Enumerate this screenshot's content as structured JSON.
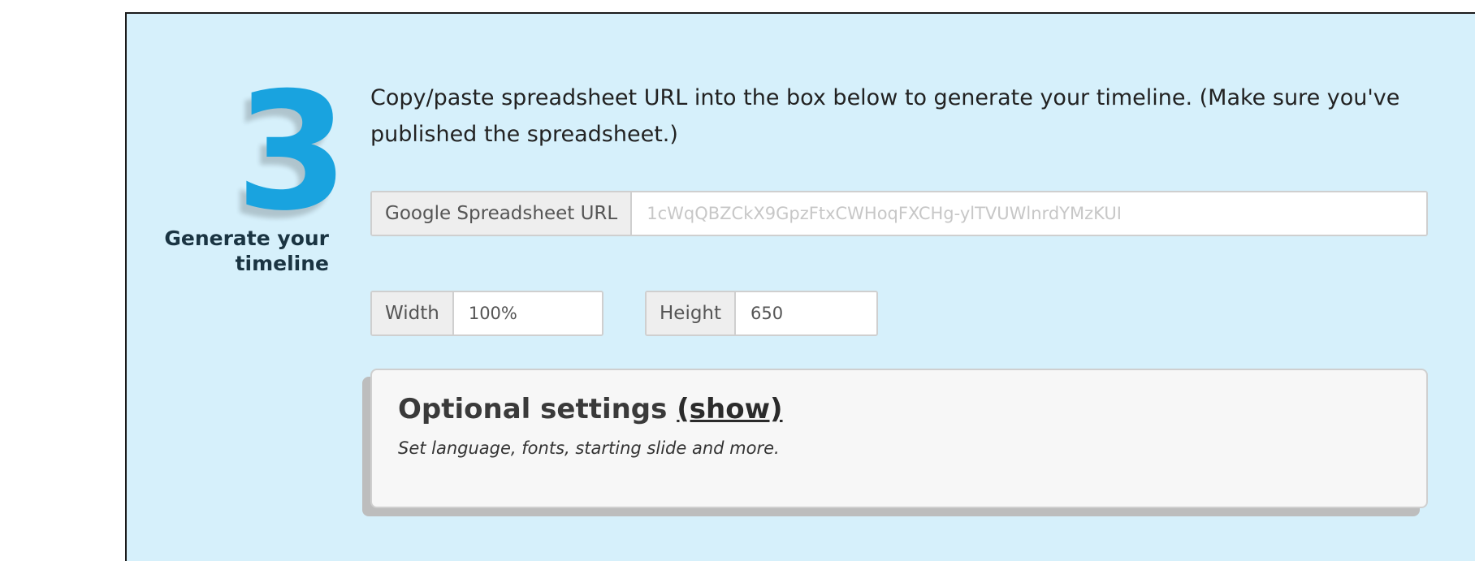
{
  "step": {
    "number": "3",
    "label": "Generate your timeline"
  },
  "instructions": "Copy/paste spreadsheet URL into the box below to generate your timeline. (Make sure you've published the spreadsheet.)",
  "url_field": {
    "label": "Google Spreadsheet URL",
    "value": "",
    "placeholder": "1cWqQBZCkX9GpzFtxCWHoqFXCHg-ylTVUWlnrdYMzKUI"
  },
  "width_field": {
    "label": "Width",
    "value": "100%"
  },
  "height_field": {
    "label": "Height",
    "value": "650"
  },
  "optional": {
    "title": "Optional settings",
    "toggle": "(show)",
    "description": "Set language, fonts, starting slide and more."
  },
  "colors": {
    "panel_bg": "#d6f0fb",
    "step_number": "#19a3df",
    "label_text": "#1a3442"
  }
}
